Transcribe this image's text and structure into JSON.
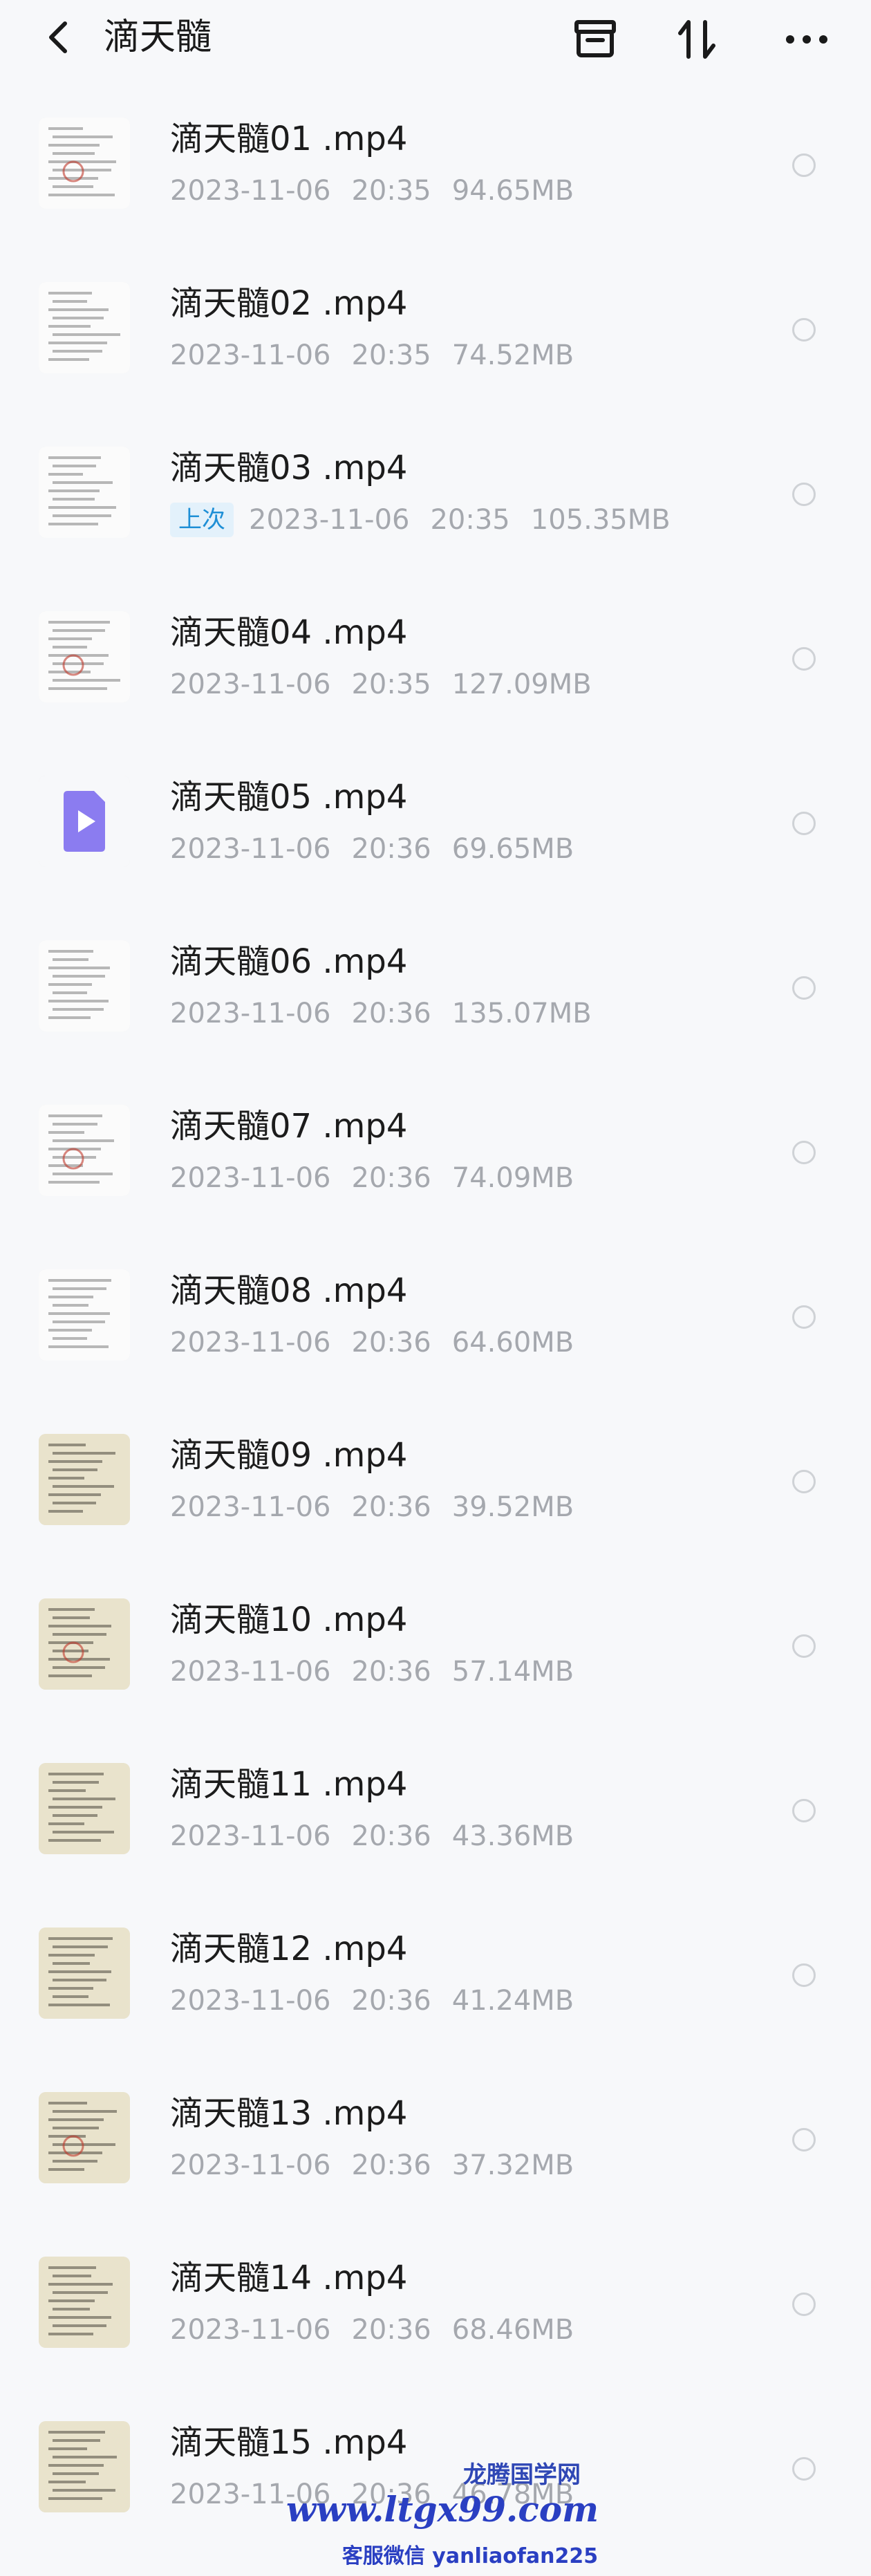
{
  "header": {
    "title": "滴天髓",
    "icons": [
      "back-arrow-icon",
      "archive-box-icon",
      "sort-icon",
      "more-icon"
    ]
  },
  "files": [
    {
      "name": "滴天髓01 .mp4",
      "date": "2023-11-06",
      "time": "20:35",
      "size": "94.65MB",
      "badge": "",
      "thumb": "doc"
    },
    {
      "name": "滴天髓02 .mp4",
      "date": "2023-11-06",
      "time": "20:35",
      "size": "74.52MB",
      "badge": "",
      "thumb": "doc"
    },
    {
      "name": "滴天髓03 .mp4",
      "date": "2023-11-06",
      "time": "20:35",
      "size": "105.35MB",
      "badge": "上次",
      "thumb": "doc"
    },
    {
      "name": "滴天髓04 .mp4",
      "date": "2023-11-06",
      "time": "20:35",
      "size": "127.09MB",
      "badge": "",
      "thumb": "doc"
    },
    {
      "name": "滴天髓05 .mp4",
      "date": "2023-11-06",
      "time": "20:36",
      "size": "69.65MB",
      "badge": "",
      "thumb": "video"
    },
    {
      "name": "滴天髓06 .mp4",
      "date": "2023-11-06",
      "time": "20:36",
      "size": "135.07MB",
      "badge": "",
      "thumb": "doc"
    },
    {
      "name": "滴天髓07 .mp4",
      "date": "2023-11-06",
      "time": "20:36",
      "size": "74.09MB",
      "badge": "",
      "thumb": "doc"
    },
    {
      "name": "滴天髓08 .mp4",
      "date": "2023-11-06",
      "time": "20:36",
      "size": "64.60MB",
      "badge": "",
      "thumb": "doc"
    },
    {
      "name": "滴天髓09 .mp4",
      "date": "2023-11-06",
      "time": "20:36",
      "size": "39.52MB",
      "badge": "",
      "thumb": "paper"
    },
    {
      "name": "滴天髓10 .mp4",
      "date": "2023-11-06",
      "time": "20:36",
      "size": "57.14MB",
      "badge": "",
      "thumb": "paper"
    },
    {
      "name": "滴天髓11 .mp4",
      "date": "2023-11-06",
      "time": "20:36",
      "size": "43.36MB",
      "badge": "",
      "thumb": "paper"
    },
    {
      "name": "滴天髓12 .mp4",
      "date": "2023-11-06",
      "time": "20:36",
      "size": "41.24MB",
      "badge": "",
      "thumb": "paper"
    },
    {
      "name": "滴天髓13 .mp4",
      "date": "2023-11-06",
      "time": "20:36",
      "size": "37.32MB",
      "badge": "",
      "thumb": "paper"
    },
    {
      "name": "滴天髓14 .mp4",
      "date": "2023-11-06",
      "time": "20:36",
      "size": "68.46MB",
      "badge": "",
      "thumb": "paper"
    },
    {
      "name": "滴天髓15 .mp4",
      "date": "2023-11-06",
      "time": "20:36",
      "size": "46.78MB",
      "badge": "",
      "thumb": "paper"
    }
  ],
  "watermark": {
    "line1": "龙腾国学网",
    "line2": "www.ltgx99.com",
    "line3": "客服微信 yanliaofan225"
  },
  "colors": {
    "background": "#f7f8fa",
    "badge_bg": "#e3f1fb",
    "badge_text": "#1e8fd6",
    "video_icon": "#8b7cf0",
    "meta_text": "#a5a8ae"
  }
}
